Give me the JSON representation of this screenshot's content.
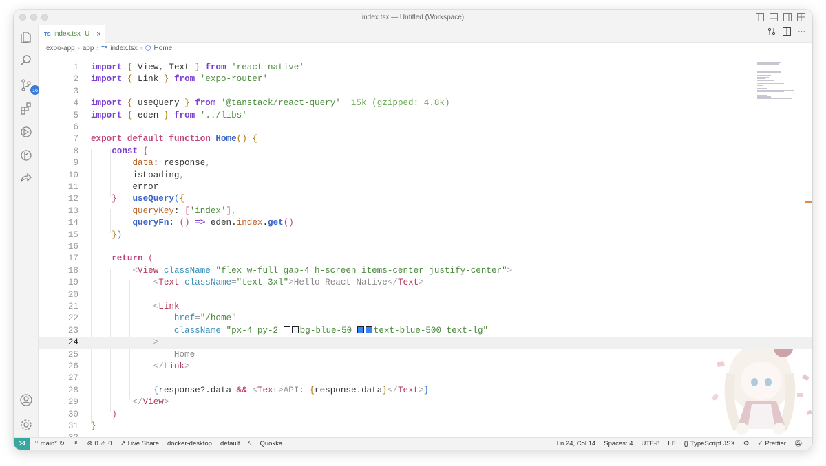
{
  "window": {
    "title": "index.tsx — Untitled (Workspace)"
  },
  "activity_bar": {
    "scm_badge": "16"
  },
  "tab": {
    "type_badge": "TS",
    "file": "index.tsx",
    "status": "U",
    "close": "×"
  },
  "breadcrumb": {
    "parts": [
      "expo-app",
      "app",
      "index.tsx",
      "Home"
    ],
    "type_badge": "TS"
  },
  "editor": {
    "active_line": 24,
    "line_numbers": [
      "1",
      "2",
      "3",
      "4",
      "5",
      "6",
      "7",
      "8",
      "9",
      "10",
      "11",
      "12",
      "13",
      "14",
      "15",
      "16",
      "17",
      "18",
      "19",
      "20",
      "21",
      "22",
      "23",
      "24",
      "25",
      "26",
      "27",
      "28",
      "29",
      "30",
      "31",
      "32"
    ],
    "lines": [
      [
        [
          "kw",
          "import"
        ],
        [
          "plain",
          " "
        ],
        [
          "br",
          "{"
        ],
        [
          "plain",
          " View, Text "
        ],
        [
          "br",
          "}"
        ],
        [
          "plain",
          " "
        ],
        [
          "kw",
          "from"
        ],
        [
          "plain",
          " "
        ],
        [
          "str",
          "'react-native'"
        ]
      ],
      [
        [
          "kw",
          "import"
        ],
        [
          "plain",
          " "
        ],
        [
          "br",
          "{"
        ],
        [
          "plain",
          " Link "
        ],
        [
          "br",
          "}"
        ],
        [
          "plain",
          " "
        ],
        [
          "kw",
          "from"
        ],
        [
          "plain",
          " "
        ],
        [
          "str",
          "'expo-router'"
        ]
      ],
      [],
      [
        [
          "kw",
          "import"
        ],
        [
          "plain",
          " "
        ],
        [
          "br",
          "{"
        ],
        [
          "plain",
          " useQuery "
        ],
        [
          "br",
          "}"
        ],
        [
          "plain",
          " "
        ],
        [
          "kw",
          "from"
        ],
        [
          "plain",
          " "
        ],
        [
          "str",
          "'@tanstack/react-query'"
        ],
        [
          "hint",
          "  15k (gzipped: 4.8k)"
        ]
      ],
      [
        [
          "kw",
          "import"
        ],
        [
          "plain",
          " "
        ],
        [
          "br",
          "{"
        ],
        [
          "plain",
          " eden "
        ],
        [
          "br",
          "}"
        ],
        [
          "plain",
          " "
        ],
        [
          "kw",
          "from"
        ],
        [
          "plain",
          " "
        ],
        [
          "str",
          "'../libs'"
        ]
      ],
      [],
      [
        [
          "kw2",
          "export"
        ],
        [
          "plain",
          " "
        ],
        [
          "kw2",
          "default"
        ],
        [
          "plain",
          " "
        ],
        [
          "kw2",
          "function"
        ],
        [
          "plain",
          " "
        ],
        [
          "fn",
          "Home"
        ],
        [
          "br",
          "()"
        ],
        [
          "plain",
          " "
        ],
        [
          "br",
          "{"
        ]
      ],
      [
        [
          "plain",
          "    "
        ],
        [
          "kw",
          "const"
        ],
        [
          "plain",
          " "
        ],
        [
          "br2",
          "{"
        ]
      ],
      [
        [
          "plain",
          "        "
        ],
        [
          "prop2",
          "data"
        ],
        [
          "plain",
          ": response"
        ],
        [
          "punc",
          ","
        ]
      ],
      [
        [
          "plain",
          "        isLoading"
        ],
        [
          "punc",
          ","
        ]
      ],
      [
        [
          "plain",
          "        error"
        ]
      ],
      [
        [
          "plain",
          "    "
        ],
        [
          "br2",
          "}"
        ],
        [
          "plain",
          " = "
        ],
        [
          "fn",
          "useQuery"
        ],
        [
          "br3",
          "("
        ],
        [
          "br",
          "{"
        ]
      ],
      [
        [
          "plain",
          "        "
        ],
        [
          "prop2",
          "queryKey"
        ],
        [
          "plain",
          ": "
        ],
        [
          "br2",
          "["
        ],
        [
          "str",
          "'index'"
        ],
        [
          "br2",
          "]"
        ],
        [
          "punc",
          ","
        ]
      ],
      [
        [
          "plain",
          "        "
        ],
        [
          "prop",
          "queryFn"
        ],
        [
          "plain",
          ": "
        ],
        [
          "br2",
          "()"
        ],
        [
          "plain",
          " "
        ],
        [
          "kw",
          "=>"
        ],
        [
          "plain",
          " eden."
        ],
        [
          "prop2",
          "index"
        ],
        [
          "plain",
          "."
        ],
        [
          "fn",
          "get"
        ],
        [
          "br2",
          "()"
        ]
      ],
      [
        [
          "plain",
          "    "
        ],
        [
          "br",
          "}"
        ],
        [
          "br3",
          ")"
        ]
      ],
      [],
      [
        [
          "plain",
          "    "
        ],
        [
          "kw2",
          "return"
        ],
        [
          "plain",
          " "
        ],
        [
          "br2",
          "("
        ]
      ],
      [
        [
          "plain",
          "        "
        ],
        [
          "punc",
          "<"
        ],
        [
          "tag",
          "View"
        ],
        [
          "plain",
          " "
        ],
        [
          "attr",
          "className"
        ],
        [
          "punc",
          "="
        ],
        [
          "str",
          "\"flex w-full gap-4 h-screen items-center justify-center\""
        ],
        [
          "punc",
          ">"
        ]
      ],
      [
        [
          "plain",
          "            "
        ],
        [
          "punc",
          "<"
        ],
        [
          "tag",
          "Text"
        ],
        [
          "plain",
          " "
        ],
        [
          "attr",
          "className"
        ],
        [
          "punc",
          "="
        ],
        [
          "str",
          "\"text-3xl\""
        ],
        [
          "punc",
          ">"
        ],
        [
          "gray",
          "Hello React Native"
        ],
        [
          "punc",
          "</"
        ],
        [
          "tag",
          "Text"
        ],
        [
          "punc",
          ">"
        ]
      ],
      [],
      [
        [
          "plain",
          "            "
        ],
        [
          "punc",
          "<"
        ],
        [
          "tag",
          "Link"
        ]
      ],
      [
        [
          "plain",
          "                "
        ],
        [
          "attr",
          "href"
        ],
        [
          "punc",
          "="
        ],
        [
          "str",
          "\"/home\""
        ]
      ],
      [
        [
          "plain",
          "                "
        ],
        [
          "attr",
          "className"
        ],
        [
          "punc",
          "="
        ],
        [
          "str",
          "\"px-4 py-2 "
        ],
        [
          "sw",
          "#ffffff"
        ],
        [
          "sw",
          "#eff6ff"
        ],
        [
          "str",
          "bg-blue-50 "
        ],
        [
          "sw",
          "#3b82f6"
        ],
        [
          "sw",
          "#3b82f6"
        ],
        [
          "str",
          "text-blue-500 text-lg\""
        ]
      ],
      [
        [
          "plain",
          "            "
        ],
        [
          "punc",
          ">"
        ]
      ],
      [
        [
          "plain",
          "                "
        ],
        [
          "gray",
          "Home"
        ]
      ],
      [
        [
          "plain",
          "            "
        ],
        [
          "punc",
          "</"
        ],
        [
          "tag",
          "Link"
        ],
        [
          "punc",
          ">"
        ]
      ],
      [],
      [
        [
          "plain",
          "            "
        ],
        [
          "br3",
          "{"
        ],
        [
          "plain",
          "response?.data "
        ],
        [
          "kw2",
          "&&"
        ],
        [
          "plain",
          " "
        ],
        [
          "punc",
          "<"
        ],
        [
          "tag",
          "Text"
        ],
        [
          "punc",
          ">"
        ],
        [
          "gray",
          "API: "
        ],
        [
          "br",
          "{"
        ],
        [
          "plain",
          "response.data"
        ],
        [
          "br",
          "}"
        ],
        [
          "punc",
          "</"
        ],
        [
          "tag",
          "Text"
        ],
        [
          "punc",
          ">"
        ],
        [
          "br3",
          "}"
        ]
      ],
      [
        [
          "plain",
          "        "
        ],
        [
          "punc",
          "</"
        ],
        [
          "tag",
          "View"
        ],
        [
          "punc",
          ">"
        ]
      ],
      [
        [
          "plain",
          "    "
        ],
        [
          "br2",
          ")"
        ]
      ],
      [
        [
          "br",
          "}"
        ]
      ],
      []
    ]
  },
  "statusbar": {
    "branch": "main*",
    "errors": "0",
    "warnings": "0",
    "live_share": "Live Share",
    "docker": "docker-desktop",
    "profile": "default",
    "quokka": "Quokka",
    "position": "Ln 24, Col 14",
    "spaces": "Spaces: 4",
    "encoding": "UTF-8",
    "eol": "LF",
    "language": "TypeScript JSX",
    "formatter": "Prettier"
  }
}
